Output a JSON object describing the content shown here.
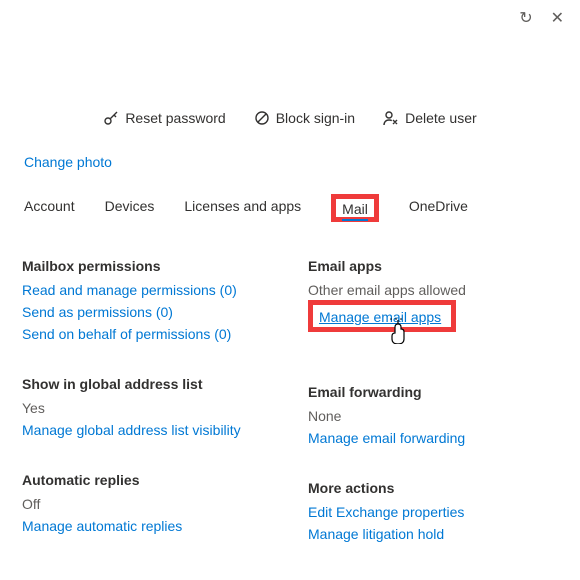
{
  "top": {
    "refresh": "↻",
    "close": "✕"
  },
  "actions": {
    "reset_password": "Reset password",
    "block_signin": "Block sign-in",
    "delete_user": "Delete user"
  },
  "change_photo": "Change photo",
  "tabs": {
    "account": "Account",
    "devices": "Devices",
    "licenses": "Licenses and apps",
    "mail": "Mail",
    "onedrive": "OneDrive"
  },
  "sections": {
    "mailbox_permissions": {
      "heading": "Mailbox permissions",
      "read_manage": "Read and manage permissions (0)",
      "send_as": "Send as permissions (0)",
      "send_behalf": "Send on behalf of permissions (0)"
    },
    "show_gal": {
      "heading": "Show in global address list",
      "value": "Yes",
      "manage": "Manage global address list visibility"
    },
    "auto_replies": {
      "heading": "Automatic replies",
      "value": "Off",
      "manage": "Manage automatic replies"
    },
    "email_apps": {
      "heading": "Email apps",
      "value": "Other email apps allowed",
      "manage": "Manage email apps"
    },
    "email_fwd": {
      "heading": "Email forwarding",
      "value": "None",
      "manage": "Manage email forwarding"
    },
    "more_actions": {
      "heading": "More actions",
      "edit_exchange": "Edit Exchange properties",
      "litigation": "Manage litigation hold"
    }
  }
}
